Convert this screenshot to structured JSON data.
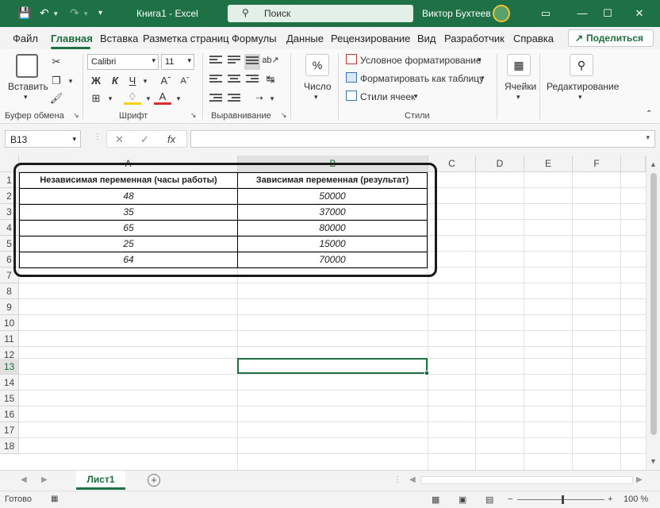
{
  "titlebar": {
    "app_title": "Книга1  -  Excel",
    "search_label": "Поиск",
    "user_name": "Виктор Бухтеев",
    "minimize": "—",
    "maximize": "☐",
    "close": "✕"
  },
  "tabs": [
    "Файл",
    "Главная",
    "Вставка",
    "Разметка страниц",
    "Формулы",
    "Данные",
    "Рецензирование",
    "Вид",
    "Разработчик",
    "Справка"
  ],
  "share_label": "Поделиться",
  "ribbon": {
    "paste_label": "Вставить",
    "clipboard_group": "Буфер обмена",
    "font_name": "Calibri",
    "font_size": "11",
    "bold": "Ж",
    "italic": "К",
    "underline": "Ч",
    "font_group": "Шрифт",
    "alignment_group": "Выравнивание",
    "number_label": "Число",
    "number_symbol": "%",
    "cond_format": "Условное форматирование",
    "format_table": "Форматировать как таблицу",
    "cell_styles": "Стили ячеек",
    "styles_group": "Стили",
    "cells_label": "Ячейки",
    "editing_label": "Редактирование"
  },
  "formula_bar": {
    "name_box": "B13",
    "cancel": "✕",
    "enter": "✓",
    "fx": "fx",
    "formula": ""
  },
  "columns": [
    "A",
    "B",
    "C",
    "D",
    "E",
    "F"
  ],
  "rows": [
    "1",
    "2",
    "3",
    "4",
    "5",
    "6",
    "7",
    "8",
    "9",
    "10",
    "11",
    "12",
    "13",
    "14",
    "15",
    "16",
    "17",
    "18"
  ],
  "table": {
    "header_a": "Независимая переменная (часы работы)",
    "header_b": "Зависимая переменная (результат)",
    "rows": [
      {
        "a": "48",
        "b": "50000"
      },
      {
        "a": "35",
        "b": "37000"
      },
      {
        "a": "65",
        "b": "80000"
      },
      {
        "a": "25",
        "b": "15000"
      },
      {
        "a": "64",
        "b": "70000"
      }
    ]
  },
  "sheet_tab": "Лист1",
  "add_sheet": "+",
  "status": {
    "ready": "Готово",
    "zoom": "100 %",
    "minus": "−",
    "plus": "+"
  },
  "colors": {
    "accent": "#1e7145",
    "accent_text": "#1e6b3c"
  }
}
